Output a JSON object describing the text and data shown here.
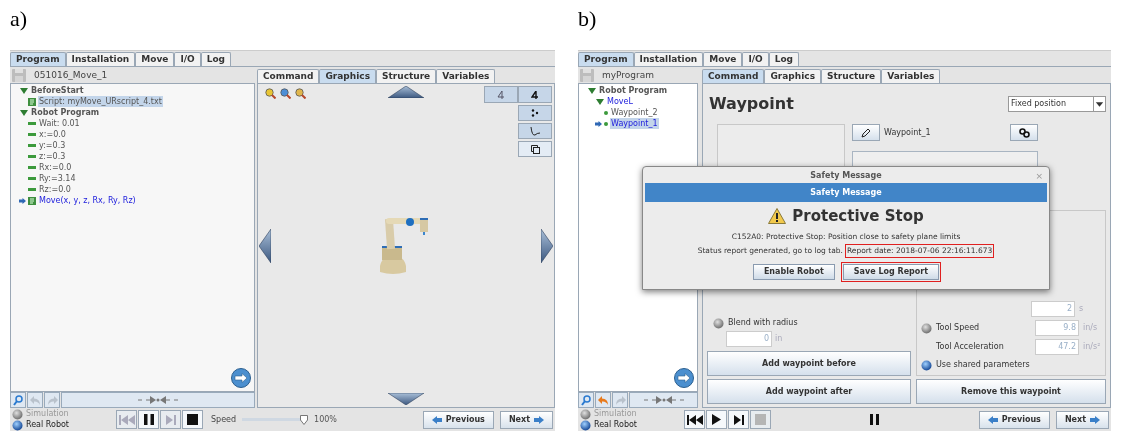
{
  "panel_a": {
    "label": "a)",
    "tabs": [
      {
        "label": "Program",
        "selected": true
      },
      {
        "label": "Installation",
        "selected": false
      },
      {
        "label": "Move",
        "selected": false
      },
      {
        "label": "I/O",
        "selected": false
      },
      {
        "label": "Log",
        "selected": false
      }
    ],
    "program_name": "051016_Move_1",
    "tree": [
      {
        "kind": "folder",
        "label": "BeforeStart",
        "expanded": true,
        "selected": false,
        "active": false,
        "pointer": false,
        "children": [
          {
            "kind": "script",
            "label": "Script: myMove_URscript_4.txt",
            "selected": true,
            "active": false,
            "pointer": false
          }
        ]
      },
      {
        "kind": "folder",
        "label": "Robot Program",
        "expanded": true,
        "selected": false,
        "active": false,
        "pointer": false,
        "children": [
          {
            "kind": "assign",
            "label": "Wait: 0.01",
            "selected": false,
            "active": false,
            "pointer": false
          },
          {
            "kind": "assign",
            "label": "x:=0.0",
            "selected": false,
            "active": false,
            "pointer": false
          },
          {
            "kind": "assign",
            "label": "y:=0.3",
            "selected": false,
            "active": false,
            "pointer": false
          },
          {
            "kind": "assign",
            "label": "z:=0.3",
            "selected": false,
            "active": false,
            "pointer": false
          },
          {
            "kind": "assign",
            "label": "Rx:=0.0",
            "selected": false,
            "active": false,
            "pointer": false
          },
          {
            "kind": "assign",
            "label": "Ry:=3.14",
            "selected": false,
            "active": false,
            "pointer": false
          },
          {
            "kind": "assign",
            "label": "Rz:=0.0",
            "selected": false,
            "active": false,
            "pointer": false
          },
          {
            "kind": "script",
            "label": "Move(x, y, z, Rx, Ry, Rz)",
            "selected": false,
            "active": true,
            "pointer": true
          }
        ]
      }
    ],
    "subtabs": [
      {
        "label": "Command",
        "selected": false
      },
      {
        "label": "Graphics",
        "selected": true
      },
      {
        "label": "Structure",
        "selected": false
      },
      {
        "label": "Variables",
        "selected": false
      }
    ],
    "footer": {
      "modes": [
        {
          "label": "Simulation",
          "selected": false
        },
        {
          "label": "Real Robot",
          "selected": true
        }
      ],
      "playback": [
        {
          "kind": "skip-back",
          "disabled": true
        },
        {
          "kind": "pause",
          "disabled": false
        },
        {
          "kind": "step",
          "disabled": true
        },
        {
          "kind": "stop",
          "disabled": false
        }
      ],
      "speed": {
        "label": "Speed",
        "level": 1,
        "reading": "100%"
      },
      "nav": [
        {
          "kind": "previous",
          "label": "Previous"
        },
        {
          "kind": "next",
          "label": "Next"
        }
      ]
    }
  },
  "panel_b": {
    "label": "b)",
    "tabs": [
      {
        "label": "Program",
        "selected": true
      },
      {
        "label": "Installation",
        "selected": false
      },
      {
        "label": "Move",
        "selected": false
      },
      {
        "label": "I/O",
        "selected": false
      },
      {
        "label": "Log",
        "selected": false
      }
    ],
    "program_name": "myProgram",
    "tree": [
      {
        "kind": "folder",
        "label": "Robot Program",
        "expanded": true,
        "selected": false,
        "active": false,
        "pointer": false,
        "children": [
          {
            "kind": "folder",
            "label": "MoveL",
            "expanded": true,
            "selected": false,
            "active": true,
            "pointer": false,
            "children": [
              {
                "kind": "waypoint",
                "label": "Waypoint_2",
                "selected": false,
                "active": false,
                "pointer": false
              },
              {
                "kind": "waypoint",
                "label": "Waypoint_1",
                "selected": true,
                "active": true,
                "pointer": true
              }
            ]
          }
        ]
      }
    ],
    "subtabs": [
      {
        "label": "Command",
        "selected": true
      },
      {
        "label": "Graphics",
        "selected": false
      },
      {
        "label": "Structure",
        "selected": false
      },
      {
        "label": "Variables",
        "selected": false
      }
    ],
    "waypoint": {
      "title": "Waypoint",
      "position_type": "Fixed position",
      "name": "Waypoint_1",
      "time": {
        "value": "2",
        "unit": "s"
      },
      "blend": {
        "label": "Blend with radius",
        "selected": false,
        "value": "0",
        "unit": "in"
      },
      "tool_speed": {
        "label": "Tool Speed",
        "selected": false,
        "value": "9.8",
        "unit": "in/s"
      },
      "tool_acceleration": {
        "label": "Tool Acceleration",
        "value": "47.2",
        "unit": "in/s²"
      },
      "shared": {
        "label": "Use shared parameters",
        "selected": true
      },
      "buttons": [
        "Add waypoint before",
        "Add waypoint after",
        "Remove this waypoint"
      ]
    },
    "dialog": {
      "window_title": "Safety Message",
      "close": "×",
      "header": "Safety Message",
      "title": "Protective Stop",
      "message": "C152A0: Protective Stop: Position close to safety plane limits",
      "status": "Status report generated, go to log tab.",
      "report_date": {
        "text": "Report date: 2018-07-06 22:16:11.673",
        "highlighted": true
      },
      "buttons": [
        {
          "label": "Enable Robot",
          "highlighted": false
        },
        {
          "label": "Save Log Report",
          "highlighted": true
        }
      ]
    },
    "footer": {
      "modes": [
        {
          "label": "Simulation",
          "selected": false
        },
        {
          "label": "Real Robot",
          "selected": true
        }
      ],
      "playback": [
        {
          "kind": "skip-back",
          "disabled": false
        },
        {
          "kind": "play",
          "disabled": false
        },
        {
          "kind": "step",
          "disabled": false
        },
        {
          "kind": "stop",
          "disabled": true
        }
      ],
      "nav": [
        {
          "kind": "previous",
          "label": "Previous"
        },
        {
          "kind": "next",
          "label": "Next"
        }
      ]
    }
  }
}
